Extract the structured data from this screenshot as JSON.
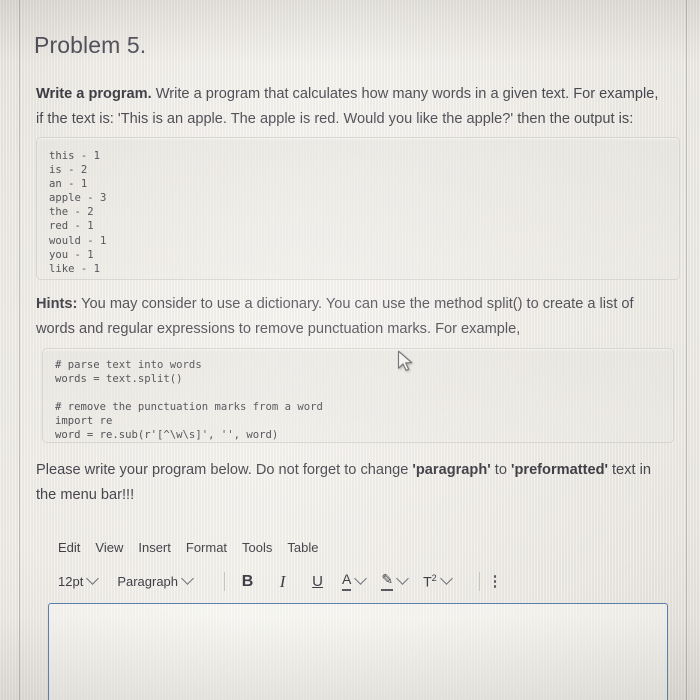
{
  "document": {
    "title": "Problem 5.",
    "intro": {
      "lead": "Write a program.",
      "body": " Write a program that calculates how many words in a given text. For example, if the text is: 'This is an apple. The apple is red. Would you like the apple?' then the output is:"
    },
    "output_example": "this - 1\nis - 2\nan - 1\napple - 3\nthe - 2\nred - 1\nwould - 1\nyou - 1\nlike - 1",
    "hints": {
      "lead": "Hints:",
      "body": " You may consider to use a dictionary. You can use the method split() to create a list of words and regular expressions to remove punctuation marks. For example,"
    },
    "hint_code": "# parse text into words\nwords = text.split()\n\n# remove the punctuation marks from a word\nimport re\nword = re.sub(r'[^\\w\\s]', '', word)",
    "instructions": {
      "part1": "Please write your program below. Do not forget to change ",
      "emphasis1": "'paragraph'",
      "part2": " to ",
      "emphasis2": "'preformatted'",
      "part3": " text in the menu bar!!!"
    }
  },
  "editor": {
    "menubar": [
      {
        "label": "Edit"
      },
      {
        "label": "View"
      },
      {
        "label": "Insert"
      },
      {
        "label": "Format"
      },
      {
        "label": "Tools"
      },
      {
        "label": "Table"
      }
    ],
    "toolbar": {
      "font_size": "12pt",
      "block_format": "Paragraph",
      "bold_label": "B",
      "italic_label": "I",
      "underline_label": "U",
      "text_color_label": "A",
      "highlight_color_label": "✎",
      "superscript_label": "T",
      "superscript_exponent": "2"
    },
    "canvas_content": ""
  },
  "theme": {
    "page_bg": "#efeee9",
    "text": "#3f3e46",
    "title": "#4c4a55",
    "code_border": "#d4d2cc",
    "editor_border": "#5d7fae"
  }
}
